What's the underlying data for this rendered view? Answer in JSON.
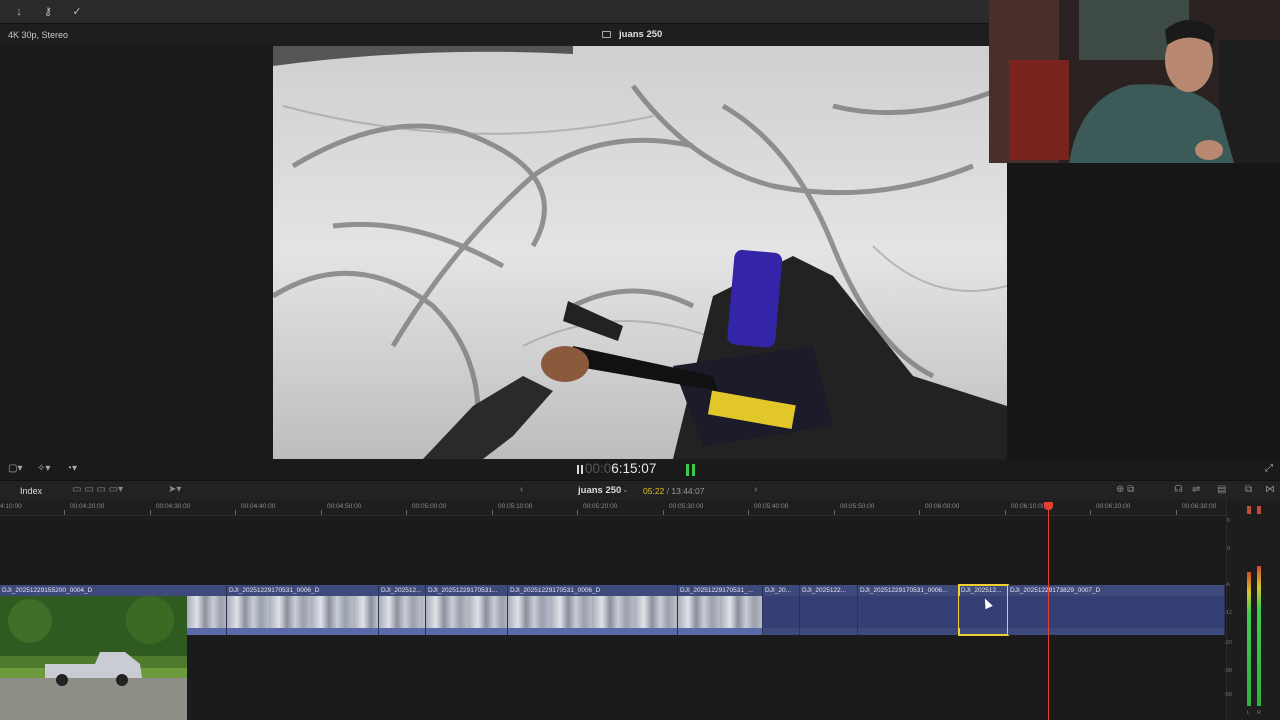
{
  "topbar": {
    "icons": [
      "download-icon",
      "key-icon",
      "checkmark-icon"
    ]
  },
  "viewer": {
    "format": "4K 30p, Stereo",
    "project_title": "juans 250",
    "timecode_dim": "00:0",
    "timecode": "6:15:07"
  },
  "timeline_header": {
    "index_label": "Index",
    "project_name": "juans 250",
    "current_time": "05:22",
    "duration_separator": " / ",
    "total_duration": "13:44:07"
  },
  "ruler": {
    "ticks": [
      "4:10:00",
      "00:04:20:00",
      "00:04:30:00",
      "00:04:40:00",
      "00:04:50:00",
      "00:05:00:00",
      "00:05:10:00",
      "00:05:20:00",
      "00:05:30:00",
      "00:05:40:00",
      "00:05:50:00",
      "00:06:00:00",
      "00:06:10:00",
      "00:06:20:00",
      "00:06:30:00"
    ]
  },
  "clips": [
    "DJI_20251229155200_0004_D",
    "DJI_20251229170531_0006_D",
    "DJI_202512...",
    "DJI_20251229170531...",
    "DJI_20251229170531_0006_D",
    "DJI_20251229170531_...",
    "DJI_20...",
    "DJI_2025122...",
    "DJI_20251229170531_0006...",
    "DJI_202512...",
    "DJI_20251229173829_0007_D"
  ],
  "meter": {
    "scale": [
      "6",
      "0",
      "-6",
      "-12",
      "-20",
      "-30",
      "-50"
    ],
    "channels": [
      "L",
      "R"
    ]
  },
  "colors": {
    "clip": "#3f4a7c",
    "playhead": "#e04030",
    "selection": "#f0d030",
    "timecode_accent": "#e0c020"
  }
}
